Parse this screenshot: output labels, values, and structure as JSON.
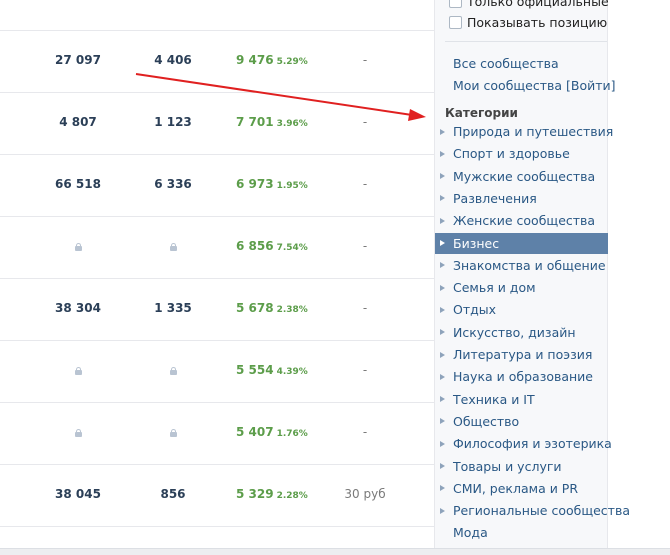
{
  "rows": [
    {
      "members": "",
      "daily": "",
      "reach": "",
      "pct": "",
      "price": ""
    },
    {
      "members": "27 097",
      "daily": "4 406",
      "reach": "9 476",
      "pct": "5.29%",
      "price": "-"
    },
    {
      "members": "4 807",
      "daily": "1 123",
      "reach": "7 701",
      "pct": "3.96%",
      "price": "-"
    },
    {
      "members": "66 518",
      "daily": "6 336",
      "reach": "6 973",
      "pct": "1.95%",
      "price": "-"
    },
    {
      "members": "lock",
      "daily": "lock",
      "reach": "6 856",
      "pct": "7.54%",
      "price": "-"
    },
    {
      "members": "38 304",
      "daily": "1 335",
      "reach": "5 678",
      "pct": "2.38%",
      "price": "-"
    },
    {
      "members": "lock",
      "daily": "lock",
      "reach": "5 554",
      "pct": "4.39%",
      "price": "-"
    },
    {
      "members": "lock",
      "daily": "lock",
      "reach": "5 407",
      "pct": "1.76%",
      "price": "-"
    },
    {
      "members": "38 045",
      "daily": "856",
      "reach": "5 329",
      "pct": "2.28%",
      "price": "30 руб"
    }
  ],
  "sidebar": {
    "official_only_label": "Только официальные",
    "show_position_label": "Показывать позицию",
    "all_communities": "Все сообщества",
    "my_communities": "Мои сообщества [Войти]",
    "categories_title": "Категории",
    "categories": [
      "Природа и путешествия",
      "Спорт и здоровье",
      "Мужские сообщества",
      "Развлечения",
      "Женские сообщества",
      "Бизнес",
      "Знакомства и общение",
      "Семья и дом",
      "Отдых",
      "Искусство, дизайн",
      "Литература и поэзия",
      "Наука и образование",
      "Техника и IT",
      "Общество",
      "Философия и эзотерика",
      "Товары и услуги",
      "СМИ, реклама и PR",
      "Региональные сообщества",
      "Мода"
    ],
    "active_category": "Бизнес"
  },
  "colors": {
    "accent_active": "#5e81a8",
    "link": "#2a5885",
    "positive": "#5c9d4a",
    "arrow": "#e02020"
  },
  "icons": {
    "lock": "lock-icon",
    "category_bullet": "triangle-right-icon",
    "annotation": "red-arrow"
  }
}
